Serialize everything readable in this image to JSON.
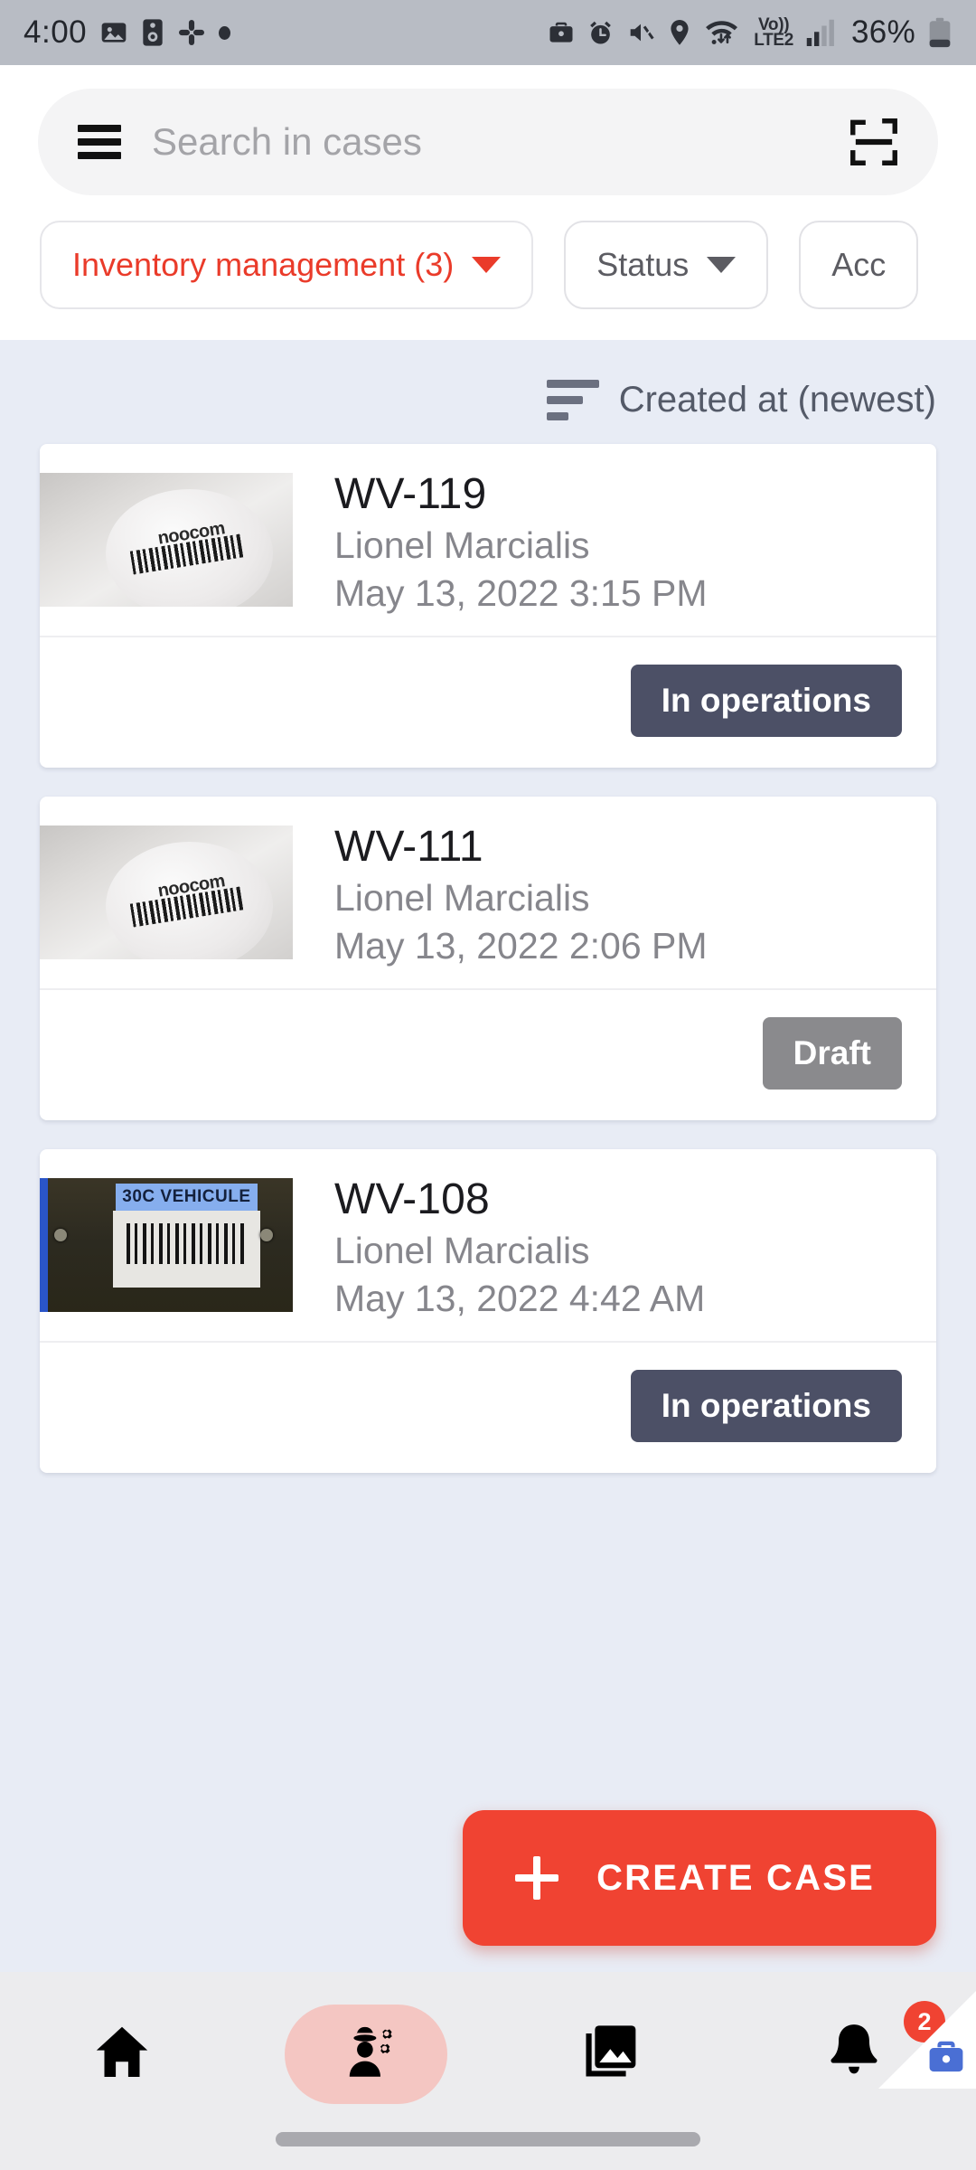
{
  "statusbar": {
    "time": "4:00",
    "left_icons": [
      "photos-icon",
      "speaker-icon",
      "slack-icon",
      "dot-indicator-icon"
    ],
    "right_icons": [
      "work-briefcase-icon",
      "alarm-icon",
      "mute-icon",
      "location-icon",
      "wifi-icon"
    ],
    "network_label_top": "Vo))",
    "network_label_bottom": "LTE2",
    "battery": "36%"
  },
  "search": {
    "placeholder": "Search in cases",
    "value": "",
    "menu_icon": "hamburger-menu-icon",
    "scan_icon": "barcode-scan-icon"
  },
  "filters": {
    "chips": [
      {
        "label": "Inventory management (3)",
        "active": true
      },
      {
        "label": "Status",
        "active": false
      },
      {
        "label": "Acc",
        "active": false
      }
    ]
  },
  "sort": {
    "icon": "sort-descending-icon",
    "label": "Created at (newest)"
  },
  "cases": [
    {
      "id": "WV-119",
      "owner": "Lionel Marcialis",
      "datetime": "May 13, 2022 3:15 PM",
      "status": "In operations",
      "status_color": "#4c5066",
      "thumb_kind": "jar",
      "thumb_label": "noocom"
    },
    {
      "id": "WV-111",
      "owner": "Lionel Marcialis",
      "datetime": "May 13, 2022 2:06 PM",
      "status": "Draft",
      "status_color": "#8a8a8d",
      "thumb_kind": "jar",
      "thumb_label": "noocom"
    },
    {
      "id": "WV-108",
      "owner": "Lionel Marcialis",
      "datetime": "May 13, 2022 4:42 AM",
      "status": "In operations",
      "status_color": "#4c5066",
      "thumb_kind": "vehicule",
      "thumb_label": "30C VEHICULE"
    }
  ],
  "fab": {
    "label": "CREATE CASE",
    "icon": "plus-icon",
    "color": "#f04332"
  },
  "bottomnav": {
    "items": [
      {
        "name": "home",
        "icon": "home-icon",
        "active": false,
        "badge": ""
      },
      {
        "name": "cases",
        "icon": "worker-settings-icon",
        "active": true,
        "badge": ""
      },
      {
        "name": "gallery",
        "icon": "photo-library-icon",
        "active": false,
        "badge": ""
      },
      {
        "name": "notifications",
        "icon": "bell-icon",
        "active": false,
        "badge": "2"
      }
    ],
    "work_profile_icon": "work-briefcase-icon"
  }
}
